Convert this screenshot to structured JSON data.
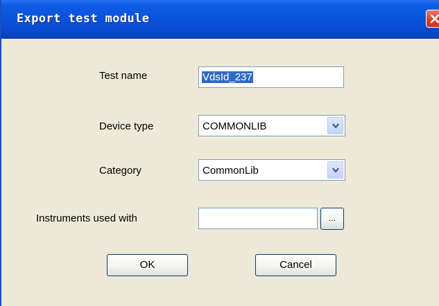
{
  "window": {
    "title": "Export test module"
  },
  "form": {
    "test_name": {
      "label": "Test name",
      "value": "VdsId_237"
    },
    "device_type": {
      "label": "Device type",
      "value": "COMMONLIB"
    },
    "category": {
      "label": "Category",
      "value": "CommonLib"
    },
    "instruments": {
      "label": "Instruments used with",
      "value": "",
      "browse_label": "..."
    }
  },
  "buttons": {
    "ok": "OK",
    "cancel": "Cancel"
  }
}
